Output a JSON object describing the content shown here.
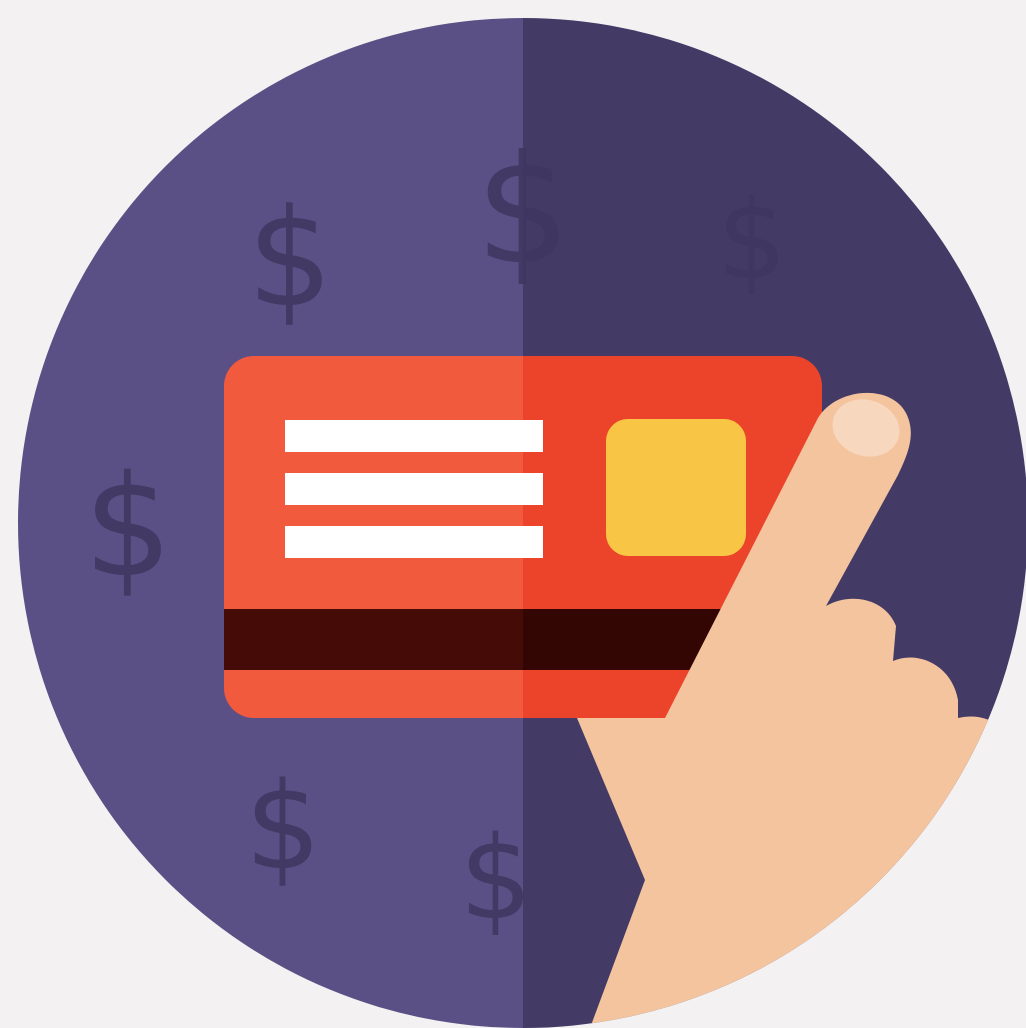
{
  "illustration": {
    "dollar_glyph": "$",
    "colors": {
      "background": "#f3f1f2",
      "circle_left": "#5b5085",
      "circle_right": "#433a66",
      "dollar": "#3f3660",
      "card_left": "#f25a3e",
      "card_right": "#ec442b",
      "card_text_lines": "#ffffff",
      "card_chip": "#f8c644",
      "card_stripe_left": "#440b07",
      "card_stripe_right": "#330503",
      "hand_skin": "#f4c49e",
      "hand_nail": "#f7d8be"
    }
  }
}
